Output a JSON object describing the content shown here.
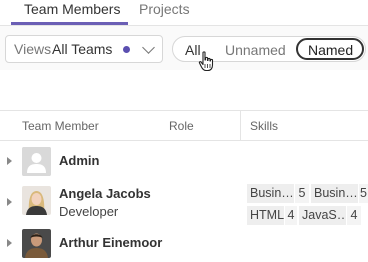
{
  "tabs": [
    {
      "label": "Team Members",
      "active": true
    },
    {
      "label": "Projects",
      "active": false
    }
  ],
  "views": {
    "label": "Views",
    "value": "All Teams"
  },
  "filter": {
    "all": "All",
    "unnamed": "Unnamed",
    "named": "Named",
    "selected": "Named"
  },
  "table": {
    "headers": {
      "member": "Team Member",
      "role": "Role",
      "skills": "Skills"
    },
    "rows": [
      {
        "name": "Admin",
        "role": ""
      },
      {
        "name": "Angela Jacobs",
        "role": "Developer",
        "skills": [
          {
            "name": "Busin…",
            "level": "5"
          },
          {
            "name": "Busin…",
            "level": "5"
          },
          {
            "name": "HTML",
            "level": "4"
          },
          {
            "name": "JavaS…",
            "level": "4"
          }
        ]
      },
      {
        "name": "Arthur Einemoor",
        "role": ""
      }
    ]
  },
  "colors": {
    "accent": "#6b5fb5",
    "dot": "#5b4fb0"
  }
}
